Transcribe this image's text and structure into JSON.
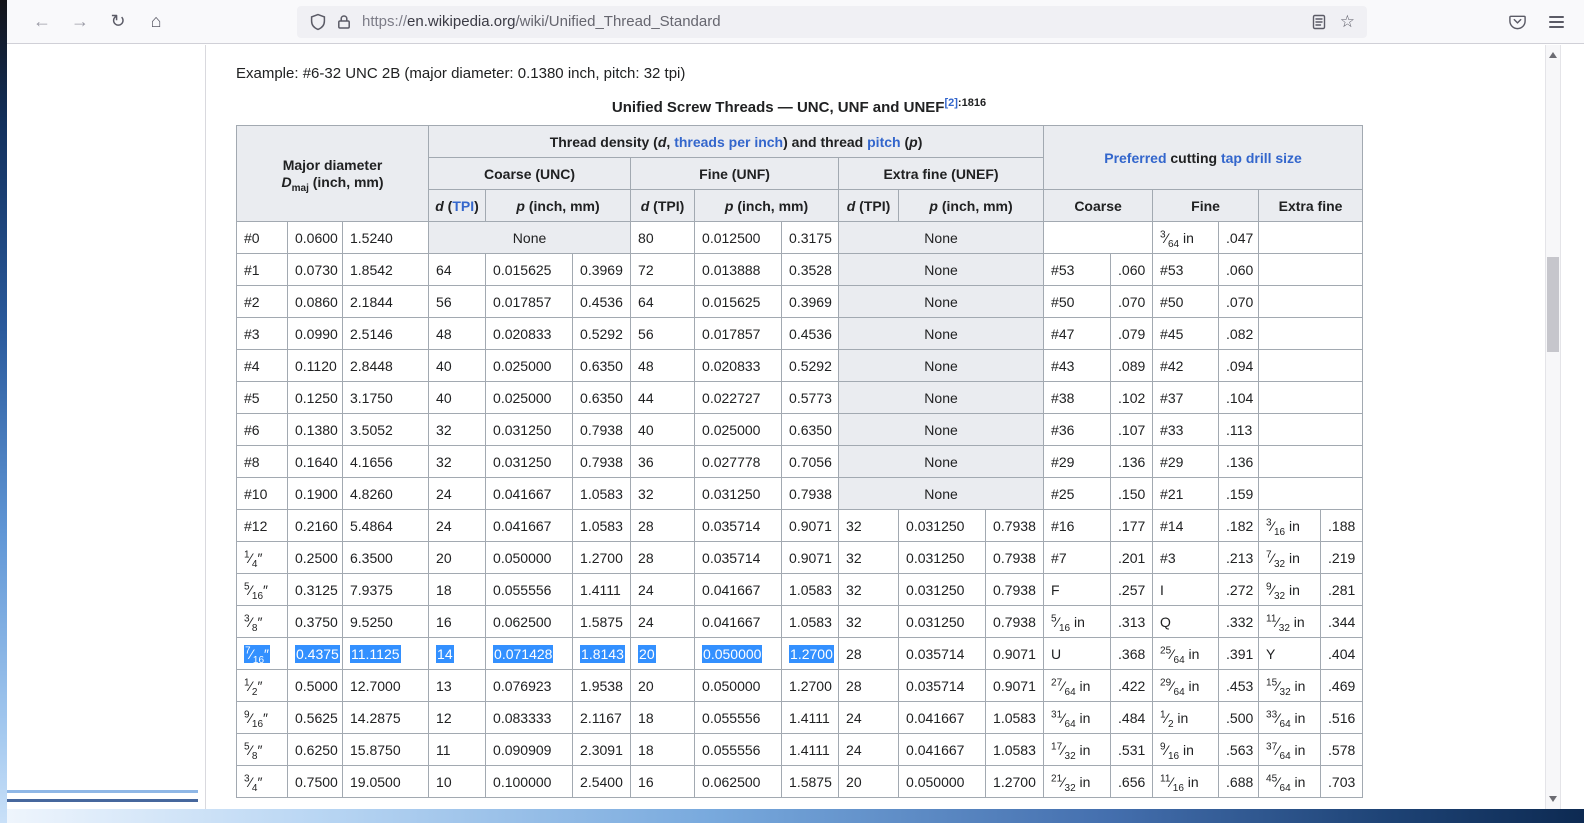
{
  "browser": {
    "url": {
      "scheme": "https://",
      "domain": "en.wikipedia.org",
      "path": "/wiki/Unified_Thread_Standard"
    },
    "icons": {
      "back": "←",
      "forward": "→",
      "reload": "↻",
      "home": "⌂",
      "star": "☆"
    }
  },
  "page": {
    "example_line": "Example: #6-32 UNC 2B (major diameter: 0.1380 inch, pitch: 32 tpi)",
    "caption": {
      "title": "Unified Screw Threads — UNC, UNF and UNEF",
      "ref": "[2]",
      "ref_page": ":1816"
    }
  },
  "table": {
    "none_label": "None",
    "header": {
      "major_line1": "Major diameter",
      "major_D": "D",
      "major_sub": "maj",
      "major_rest": " (inch, mm)",
      "density_p1": "Thread density (",
      "density_d": "d",
      "density_p2": ", ",
      "density_tpi_link": "threads per inch",
      "density_p3": ") and thread ",
      "density_pitch_link": "pitch",
      "density_p4": " (",
      "density_p": "p",
      "density_p5": ")",
      "pref_link1": "Preferred",
      "pref_mid": " cutting ",
      "pref_link2": "tap drill size",
      "coarse_unc": "Coarse (UNC)",
      "fine_unf": "Fine (UNF)",
      "extra_unef": "Extra fine (UNEF)",
      "d_label": "d",
      "d_open": " (",
      "tpi": "TPI",
      "d_close": ")",
      "p_label": "p",
      "p_rest": " (inch, mm)",
      "coarse": "Coarse",
      "fine": "Fine",
      "extra_fine": "Extra fine"
    },
    "rows": [
      {
        "size": "#0",
        "inch": "0.0600",
        "mm": "1.5240",
        "unc": null,
        "unf": {
          "d": "80",
          "p_in": "0.012500",
          "p_mm": "0.3175"
        },
        "unef": null,
        "coarse": null,
        "fine": {
          "drill": "3/64 in",
          "dec": ".047"
        },
        "extra": null
      },
      {
        "size": "#1",
        "inch": "0.0730",
        "mm": "1.8542",
        "unc": {
          "d": "64",
          "p_in": "0.015625",
          "p_mm": "0.3969"
        },
        "unf": {
          "d": "72",
          "p_in": "0.013888",
          "p_mm": "0.3528"
        },
        "unef": null,
        "coarse": {
          "drill": "#53",
          "dec": ".060"
        },
        "fine": {
          "drill": "#53",
          "dec": ".060"
        },
        "extra": null
      },
      {
        "size": "#2",
        "inch": "0.0860",
        "mm": "2.1844",
        "unc": {
          "d": "56",
          "p_in": "0.017857",
          "p_mm": "0.4536"
        },
        "unf": {
          "d": "64",
          "p_in": "0.015625",
          "p_mm": "0.3969"
        },
        "unef": null,
        "coarse": {
          "drill": "#50",
          "dec": ".070"
        },
        "fine": {
          "drill": "#50",
          "dec": ".070"
        },
        "extra": null
      },
      {
        "size": "#3",
        "inch": "0.0990",
        "mm": "2.5146",
        "unc": {
          "d": "48",
          "p_in": "0.020833",
          "p_mm": "0.5292"
        },
        "unf": {
          "d": "56",
          "p_in": "0.017857",
          "p_mm": "0.4536"
        },
        "unef": null,
        "coarse": {
          "drill": "#47",
          "dec": ".079"
        },
        "fine": {
          "drill": "#45",
          "dec": ".082"
        },
        "extra": null
      },
      {
        "size": "#4",
        "inch": "0.1120",
        "mm": "2.8448",
        "unc": {
          "d": "40",
          "p_in": "0.025000",
          "p_mm": "0.6350"
        },
        "unf": {
          "d": "48",
          "p_in": "0.020833",
          "p_mm": "0.5292"
        },
        "unef": null,
        "coarse": {
          "drill": "#43",
          "dec": ".089"
        },
        "fine": {
          "drill": "#42",
          "dec": ".094"
        },
        "extra": null
      },
      {
        "size": "#5",
        "inch": "0.1250",
        "mm": "3.1750",
        "unc": {
          "d": "40",
          "p_in": "0.025000",
          "p_mm": "0.6350"
        },
        "unf": {
          "d": "44",
          "p_in": "0.022727",
          "p_mm": "0.5773"
        },
        "unef": null,
        "coarse": {
          "drill": "#38",
          "dec": ".102"
        },
        "fine": {
          "drill": "#37",
          "dec": ".104"
        },
        "extra": null
      },
      {
        "size": "#6",
        "inch": "0.1380",
        "mm": "3.5052",
        "unc": {
          "d": "32",
          "p_in": "0.031250",
          "p_mm": "0.7938"
        },
        "unf": {
          "d": "40",
          "p_in": "0.025000",
          "p_mm": "0.6350"
        },
        "unef": null,
        "coarse": {
          "drill": "#36",
          "dec": ".107"
        },
        "fine": {
          "drill": "#33",
          "dec": ".113"
        },
        "extra": null
      },
      {
        "size": "#8",
        "inch": "0.1640",
        "mm": "4.1656",
        "unc": {
          "d": "32",
          "p_in": "0.031250",
          "p_mm": "0.7938"
        },
        "unf": {
          "d": "36",
          "p_in": "0.027778",
          "p_mm": "0.7056"
        },
        "unef": null,
        "coarse": {
          "drill": "#29",
          "dec": ".136"
        },
        "fine": {
          "drill": "#29",
          "dec": ".136"
        },
        "extra": null
      },
      {
        "size": "#10",
        "inch": "0.1900",
        "mm": "4.8260",
        "unc": {
          "d": "24",
          "p_in": "0.041667",
          "p_mm": "1.0583"
        },
        "unf": {
          "d": "32",
          "p_in": "0.031250",
          "p_mm": "0.7938"
        },
        "unef": null,
        "coarse": {
          "drill": "#25",
          "dec": ".150"
        },
        "fine": {
          "drill": "#21",
          "dec": ".159"
        },
        "extra": null
      },
      {
        "size": "#12",
        "inch": "0.2160",
        "mm": "5.4864",
        "unc": {
          "d": "24",
          "p_in": "0.041667",
          "p_mm": "1.0583"
        },
        "unf": {
          "d": "28",
          "p_in": "0.035714",
          "p_mm": "0.9071"
        },
        "unef": {
          "d": "32",
          "p_in": "0.031250",
          "p_mm": "0.7938"
        },
        "coarse": {
          "drill": "#16",
          "dec": ".177"
        },
        "fine": {
          "drill": "#14",
          "dec": ".182"
        },
        "extra": {
          "drill": "3/16 in",
          "dec": ".188"
        }
      },
      {
        "size": "1/4″",
        "inch": "0.2500",
        "mm": "6.3500",
        "unc": {
          "d": "20",
          "p_in": "0.050000",
          "p_mm": "1.2700"
        },
        "unf": {
          "d": "28",
          "p_in": "0.035714",
          "p_mm": "0.9071"
        },
        "unef": {
          "d": "32",
          "p_in": "0.031250",
          "p_mm": "0.7938"
        },
        "coarse": {
          "drill": "#7",
          "dec": ".201"
        },
        "fine": {
          "drill": "#3",
          "dec": ".213"
        },
        "extra": {
          "drill": "7/32 in",
          "dec": ".219"
        }
      },
      {
        "size": "5/16″",
        "inch": "0.3125",
        "mm": "7.9375",
        "unc": {
          "d": "18",
          "p_in": "0.055556",
          "p_mm": "1.4111"
        },
        "unf": {
          "d": "24",
          "p_in": "0.041667",
          "p_mm": "1.0583"
        },
        "unef": {
          "d": "32",
          "p_in": "0.031250",
          "p_mm": "0.7938"
        },
        "coarse": {
          "drill": "F",
          "dec": ".257"
        },
        "fine": {
          "drill": "I",
          "dec": ".272"
        },
        "extra": {
          "drill": "9/32 in",
          "dec": ".281"
        }
      },
      {
        "size": "3/8″",
        "inch": "0.3750",
        "mm": "9.5250",
        "unc": {
          "d": "16",
          "p_in": "0.062500",
          "p_mm": "1.5875"
        },
        "unf": {
          "d": "24",
          "p_in": "0.041667",
          "p_mm": "1.0583"
        },
        "unef": {
          "d": "32",
          "p_in": "0.031250",
          "p_mm": "0.7938"
        },
        "coarse": {
          "drill": "5/16 in",
          "dec": ".313"
        },
        "fine": {
          "drill": "Q",
          "dec": ".332"
        },
        "extra": {
          "drill": "11/32 in",
          "dec": ".344"
        }
      },
      {
        "size": "7/16″",
        "inch": "0.4375",
        "mm": "11.1125",
        "selected_upto": 9,
        "unc": {
          "d": "14",
          "p_in": "0.071428",
          "p_mm": "1.8143"
        },
        "unf": {
          "d": "20",
          "p_in": "0.050000",
          "p_mm": "1.2700"
        },
        "unef": {
          "d": "28",
          "p_in": "0.035714",
          "p_mm": "0.9071"
        },
        "coarse": {
          "drill": "U",
          "dec": ".368"
        },
        "fine": {
          "drill": "25/64 in",
          "dec": ".391"
        },
        "extra": {
          "drill": "Y",
          "dec": ".404"
        }
      },
      {
        "size": "1/2″",
        "inch": "0.5000",
        "mm": "12.7000",
        "unc": {
          "d": "13",
          "p_in": "0.076923",
          "p_mm": "1.9538"
        },
        "unf": {
          "d": "20",
          "p_in": "0.050000",
          "p_mm": "1.2700"
        },
        "unef": {
          "d": "28",
          "p_in": "0.035714",
          "p_mm": "0.9071"
        },
        "coarse": {
          "drill": "27/64 in",
          "dec": ".422"
        },
        "fine": {
          "drill": "29/64 in",
          "dec": ".453"
        },
        "extra": {
          "drill": "15/32 in",
          "dec": ".469"
        }
      },
      {
        "size": "9/16″",
        "inch": "0.5625",
        "mm": "14.2875",
        "unc": {
          "d": "12",
          "p_in": "0.083333",
          "p_mm": "2.1167"
        },
        "unf": {
          "d": "18",
          "p_in": "0.055556",
          "p_mm": "1.4111"
        },
        "unef": {
          "d": "24",
          "p_in": "0.041667",
          "p_mm": "1.0583"
        },
        "coarse": {
          "drill": "31/64 in",
          "dec": ".484"
        },
        "fine": {
          "drill": "1/2 in",
          "dec": ".500"
        },
        "extra": {
          "drill": "33/64 in",
          "dec": ".516"
        }
      },
      {
        "size": "5/8″",
        "inch": "0.6250",
        "mm": "15.8750",
        "unc": {
          "d": "11",
          "p_in": "0.090909",
          "p_mm": "2.3091"
        },
        "unf": {
          "d": "18",
          "p_in": "0.055556",
          "p_mm": "1.4111"
        },
        "unef": {
          "d": "24",
          "p_in": "0.041667",
          "p_mm": "1.0583"
        },
        "coarse": {
          "drill": "17/32 in",
          "dec": ".531"
        },
        "fine": {
          "drill": "9/16 in",
          "dec": ".563"
        },
        "extra": {
          "drill": "37/64 in",
          "dec": ".578"
        }
      },
      {
        "size": "3/4″",
        "inch": "0.7500",
        "mm": "19.0500",
        "unc": {
          "d": "10",
          "p_in": "0.100000",
          "p_mm": "2.5400"
        },
        "unf": {
          "d": "16",
          "p_in": "0.062500",
          "p_mm": "1.5875"
        },
        "unef": {
          "d": "20",
          "p_in": "0.050000",
          "p_mm": "1.2700"
        },
        "coarse": {
          "drill": "21/32 in",
          "dec": ".656"
        },
        "fine": {
          "drill": "11/16 in",
          "dec": ".688"
        },
        "extra": {
          "drill": "45/64 in",
          "dec": ".703"
        }
      }
    ]
  },
  "colors": {
    "selection": "#3390ff",
    "link": "#3366cc",
    "header_bg": "#eaecf0",
    "table_border": "#a2a9b1"
  }
}
